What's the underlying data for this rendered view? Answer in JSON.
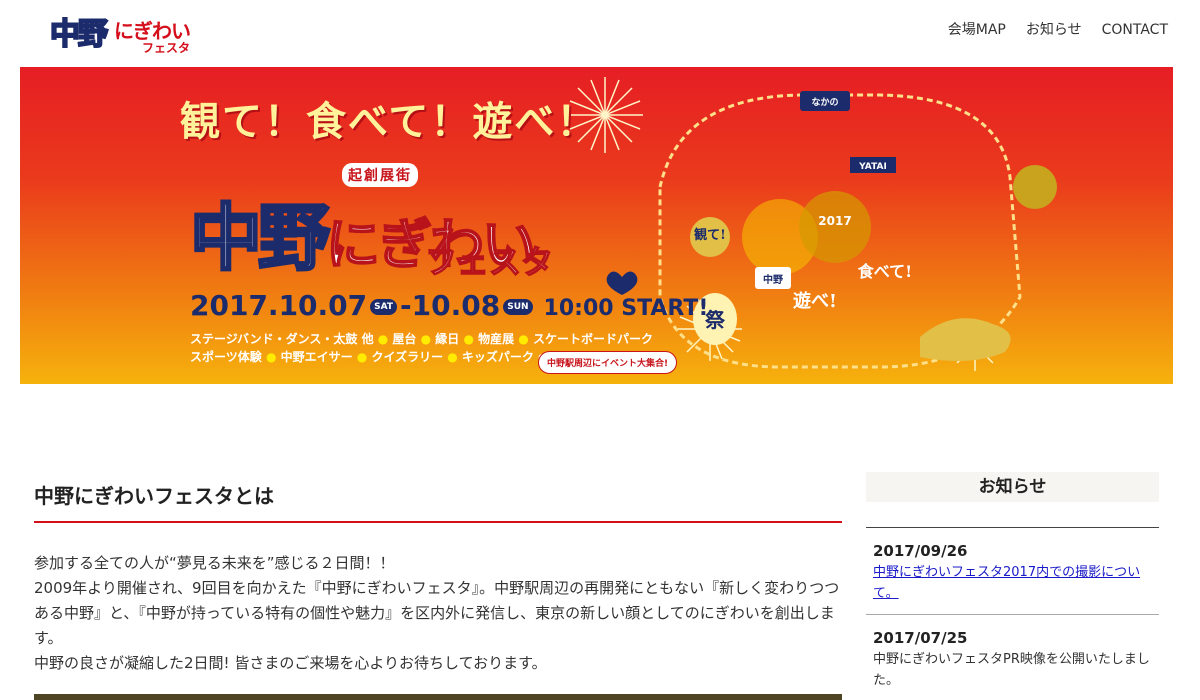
{
  "header": {
    "logo_text": "中野にぎわいフェスタ",
    "nav": [
      "会場MAP",
      "お知らせ",
      "CONTACT"
    ]
  },
  "hero": {
    "catch_copy": "観て！食べて！遊べ！",
    "tag": "起創展街",
    "title_kanji": "中野",
    "title_kana": "にぎわい",
    "title_sub": "フェスタ",
    "date_start": "2017.10.07",
    "day_start": "SAT",
    "date_end": "-10.08",
    "day_end": "SUN",
    "start_time": "10:00 START!",
    "events_line1": [
      "ステージバンド・ダンス・太鼓 他",
      "屋台",
      "縁日",
      "物産展",
      "スケートボードパーク"
    ],
    "events_line2": [
      "スポーツ体験",
      "中野エイサー",
      "クイズラリー",
      "キッズパーク etc…"
    ],
    "bubble": "中野駅周辺にイベント大集合!",
    "illust_year": "2017",
    "illust_sign1": "なかの",
    "illust_sign2": "YATAI",
    "illust_badge": "中野",
    "illust_lantern": "祭",
    "illust_words": [
      "観て!",
      "食べて!",
      "遊べ!"
    ],
    "colors": {
      "red": "#e61e24",
      "orange": "#f07a12",
      "yellow": "#f6b20c",
      "navy": "#1c2b6b",
      "gold": "#ffec00"
    }
  },
  "main": {
    "section_title": "中野にぎわいフェスタとは",
    "about_lines": [
      "参加する全ての人が“夢見る未来を”感じる２日間！！",
      "2009年より開催され、9回目を向かえた『中野にぎわいフェスタ』。中野駅周辺の再開発にともない『新しく変わりつつある中野』と、『中野が持っている特有の個性や魅力』を区内外に発信し、東京の新しい顔としてのにぎわいを創出します。",
      "中野の良さが凝縮した2日間! 皆さまのご来場を心よりお待ちしております。"
    ]
  },
  "sidebar": {
    "title": "お知らせ",
    "news": [
      {
        "date": "2017/09/26",
        "text": "中野にぎわいフェスタ2017内での撮影について。",
        "is_link": true
      },
      {
        "date": "2017/07/25",
        "text": "中野にぎわいフェスタPR映像を公開いたしました。",
        "is_link": false
      }
    ]
  }
}
